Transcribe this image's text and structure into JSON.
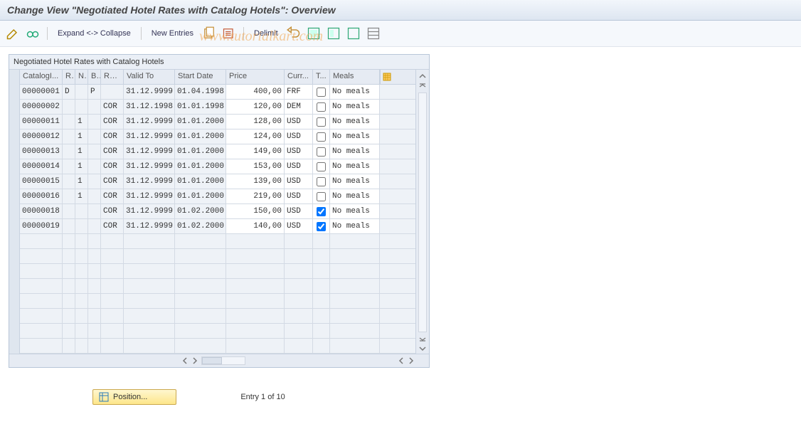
{
  "title": "Change View \"Negotiated Hotel Rates with Catalog Hotels\": Overview",
  "toolbar": {
    "expand": "Expand <-> Collapse",
    "new_entries": "New Entries",
    "delimit": "Delimit"
  },
  "watermark": "www.tutorialkart.com",
  "panel_title": "Negotiated Hotel Rates with Catalog Hotels",
  "columns": {
    "catalog": "CatalogI...",
    "r": "R...",
    "n": "N...",
    "b": "B...",
    "rate": "Rate",
    "valid": "Valid To",
    "start": "Start Date",
    "price": "Price",
    "curr": "Curr...",
    "t": "T...",
    "meals": "Meals"
  },
  "rows": [
    {
      "catalog": "00000001",
      "r": "D",
      "n": "",
      "b": "P",
      "rate": "",
      "valid": "31.12.9999",
      "start": "01.04.1998",
      "price": "400,00",
      "curr": "FRF",
      "t": false,
      "meals": "No meals"
    },
    {
      "catalog": "00000002",
      "r": "",
      "n": "",
      "b": "",
      "rate": "COR",
      "valid": "31.12.1998",
      "start": "01.01.1998",
      "price": "120,00",
      "curr": "DEM",
      "t": false,
      "meals": "No meals"
    },
    {
      "catalog": "00000011",
      "r": "",
      "n": "1",
      "b": "",
      "rate": "COR",
      "valid": "31.12.9999",
      "start": "01.01.2000",
      "price": "128,00",
      "curr": "USD",
      "t": false,
      "meals": "No meals"
    },
    {
      "catalog": "00000012",
      "r": "",
      "n": "1",
      "b": "",
      "rate": "COR",
      "valid": "31.12.9999",
      "start": "01.01.2000",
      "price": "124,00",
      "curr": "USD",
      "t": false,
      "meals": "No meals"
    },
    {
      "catalog": "00000013",
      "r": "",
      "n": "1",
      "b": "",
      "rate": "COR",
      "valid": "31.12.9999",
      "start": "01.01.2000",
      "price": "149,00",
      "curr": "USD",
      "t": false,
      "meals": "No meals"
    },
    {
      "catalog": "00000014",
      "r": "",
      "n": "1",
      "b": "",
      "rate": "COR",
      "valid": "31.12.9999",
      "start": "01.01.2000",
      "price": "153,00",
      "curr": "USD",
      "t": false,
      "meals": "No meals"
    },
    {
      "catalog": "00000015",
      "r": "",
      "n": "1",
      "b": "",
      "rate": "COR",
      "valid": "31.12.9999",
      "start": "01.01.2000",
      "price": "139,00",
      "curr": "USD",
      "t": false,
      "meals": "No meals"
    },
    {
      "catalog": "00000016",
      "r": "",
      "n": "1",
      "b": "",
      "rate": "COR",
      "valid": "31.12.9999",
      "start": "01.01.2000",
      "price": "219,00",
      "curr": "USD",
      "t": false,
      "meals": "No meals"
    },
    {
      "catalog": "00000018",
      "r": "",
      "n": "",
      "b": "",
      "rate": "COR",
      "valid": "31.12.9999",
      "start": "01.02.2000",
      "price": "150,00",
      "curr": "USD",
      "t": true,
      "meals": "No meals"
    },
    {
      "catalog": "00000019",
      "r": "",
      "n": "",
      "b": "",
      "rate": "COR",
      "valid": "31.12.9999",
      "start": "01.02.2000",
      "price": "140,00",
      "curr": "USD",
      "t": true,
      "meals": "No meals"
    }
  ],
  "empty_rows": 8,
  "footer": {
    "position": "Position...",
    "entry": "Entry 1 of 10"
  }
}
